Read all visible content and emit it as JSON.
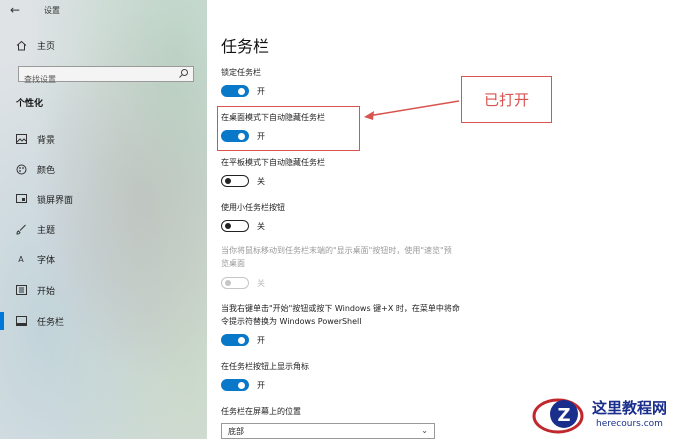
{
  "window": {
    "title": "设置",
    "back_icon": "back-arrow-icon"
  },
  "sidebar": {
    "home": {
      "label": "主页",
      "icon": "home-icon"
    },
    "search": {
      "placeholder": "查找设置",
      "icon": "search-icon"
    },
    "section_title": "个性化",
    "items": [
      {
        "label": "背景",
        "icon": "picture-icon"
      },
      {
        "label": "颜色",
        "icon": "palette-icon"
      },
      {
        "label": "锁屏界面",
        "icon": "lock-screen-icon"
      },
      {
        "label": "主题",
        "icon": "brush-icon"
      },
      {
        "label": "字体",
        "icon": "font-icon"
      },
      {
        "label": "开始",
        "icon": "start-icon"
      },
      {
        "label": "任务栏",
        "icon": "taskbar-icon",
        "selected": true
      }
    ]
  },
  "main": {
    "title": "任务栏",
    "settings": [
      {
        "label": "锁定任务栏",
        "state": "开",
        "on": true
      },
      {
        "label": "在桌面模式下自动隐藏任务栏",
        "state": "开",
        "on": true,
        "highlighted": true
      },
      {
        "label": "在平板模式下自动隐藏任务栏",
        "state": "关",
        "on": false
      },
      {
        "label": "使用小任务栏按钮",
        "state": "关",
        "on": false
      },
      {
        "label_line1": "当你将鼠标移动到任务栏末端的\"显示桌面\"按钮时，使用\"速览\"预",
        "label_line2": "览桌面",
        "state": "关",
        "on": false,
        "disabled": true
      },
      {
        "label_line1": "当我右键单击\"开始\"按钮或按下 Windows 键+X 时，在菜单中将命",
        "label_line2": "令提示符替换为 Windows PowerShell",
        "state": "开",
        "on": true
      },
      {
        "label": "在任务栏按钮上显示角标",
        "state": "开",
        "on": true
      }
    ],
    "position": {
      "label": "任务栏在屏幕上的位置",
      "value": "底部"
    }
  },
  "annotation": {
    "callout_text": "已打开",
    "color": "#d9534f"
  },
  "watermark": {
    "name": "这里教程网",
    "url": "herecours.com",
    "logo": "z-logo-icon"
  },
  "colors": {
    "accent": "#0a78c8",
    "annotation": "#d9534f",
    "watermark": "#1a2f8c"
  }
}
